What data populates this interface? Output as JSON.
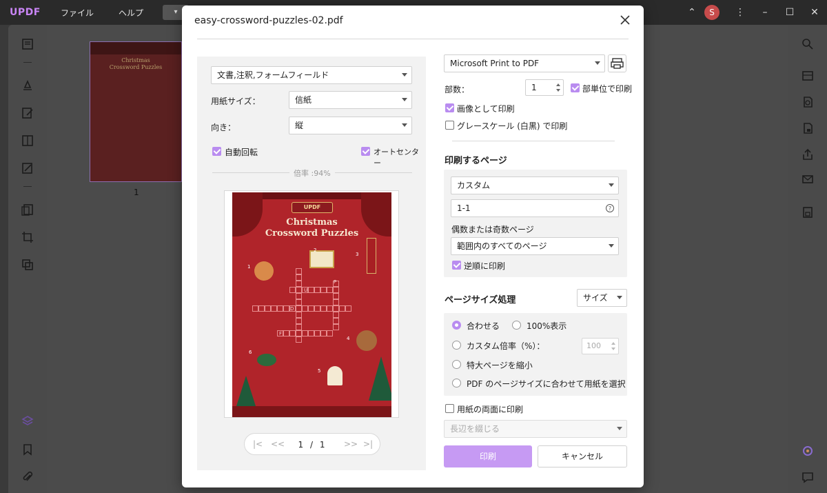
{
  "app": {
    "logo": "UPDF",
    "menu": [
      "ファイル",
      "ヘルプ"
    ],
    "tab_chip": "▾",
    "avatar_initial": "S"
  },
  "thumbnail": {
    "title_line1": "Christmas",
    "title_line2": "Crossword Puzzles",
    "page_number": "1"
  },
  "dialog": {
    "title": "easy-crossword-puzzles-02.pdf",
    "left": {
      "content_select": "文書,注釈,フォームフィールド",
      "paper_size_label": "用紙サイズ：",
      "paper_size_value": "信紙",
      "orientation_label": "向き：",
      "orientation_value": "縦",
      "auto_rotate_label": "自動回転",
      "auto_center_label": "オートセンター",
      "ratio": "倍率 :94%",
      "preview": {
        "badge": "UPDF",
        "title_line1": "Christmas",
        "title_line2": "Crossword Puzzles",
        "letters": [
          "U",
          "P",
          "D",
          "F"
        ],
        "numbers": [
          "1",
          "2",
          "3",
          "4",
          "5",
          "6"
        ]
      },
      "pager": {
        "first": "|<",
        "prev": "<<",
        "current": "1",
        "separator": "/",
        "total": "1",
        "next": ">>",
        "last": ">|"
      }
    },
    "right": {
      "printer": "Microsoft Print to PDF",
      "copies_label": "部数：",
      "copies_value": "1",
      "collate_label": "部単位で印刷",
      "print_as_image_label": "画像として印刷",
      "grayscale_label": "グレースケール (白黒) で印刷",
      "pages_heading": "印刷するページ",
      "pages_mode": "カスタム",
      "pages_range": "1-1",
      "help_glyph": "?",
      "odd_even_label": "偶数または奇数ページ",
      "odd_even_value": "範囲内のすべてのページ",
      "reverse_label": "逆順に印刷",
      "size_heading": "ページサイズ処理",
      "size_mode": "サイズ",
      "fit_label": "合わせる",
      "actual_size_label": "100%表示",
      "custom_scale_label": "カスタム倍率（%）：",
      "custom_scale_value": "100",
      "shrink_label": "特大ページを縮小",
      "choose_paper_label": "PDF のページサイズに合わせて用紙を選択",
      "duplex_label": "用紙の両面に印刷",
      "duplex_binding": "長辺を綴じる",
      "print_button": "印刷",
      "cancel_button": "キャンセル"
    }
  },
  "colors": {
    "accent": "#b98cf0",
    "print_button": "#c69af3",
    "page_red": "#b0242a",
    "logo": "#c985f5"
  }
}
